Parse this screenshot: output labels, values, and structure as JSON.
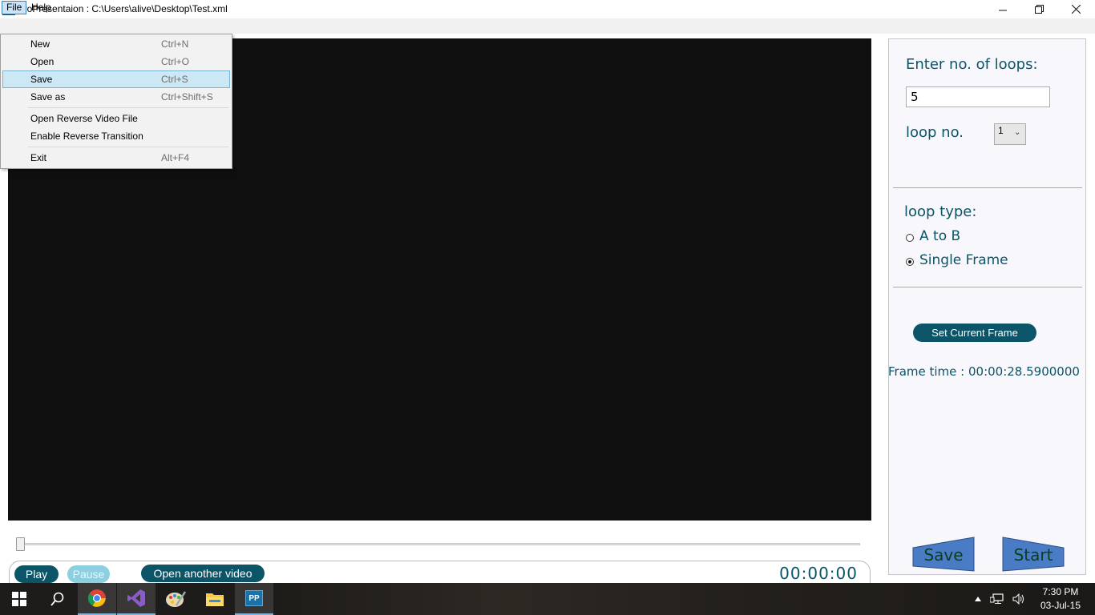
{
  "window": {
    "app_icon_text": "PP",
    "title": "proPresentaion : C:\\Users\\alive\\Desktop\\Test.xml",
    "controls": [
      "minimize-icon",
      "restore-icon",
      "close-icon"
    ]
  },
  "menubar": {
    "items": [
      {
        "label": "File"
      },
      {
        "label": "Help"
      }
    ]
  },
  "file_menu": {
    "items": [
      {
        "label": "New",
        "shortcut": "Ctrl+N",
        "highlighted": false
      },
      {
        "label": "Open",
        "shortcut": "Ctrl+O",
        "highlighted": false
      },
      {
        "label": "Save",
        "shortcut": "Ctrl+S",
        "highlighted": true
      },
      {
        "label": "Save as",
        "shortcut": "Ctrl+Shift+S",
        "highlighted": false
      },
      {
        "label": "Open Reverse Video File",
        "shortcut": ""
      },
      {
        "label": "Enable Reverse Transition",
        "shortcut": ""
      },
      {
        "label": "Exit",
        "shortcut": "Alt+F4"
      }
    ]
  },
  "player": {
    "seek_position": 0,
    "play_label": "Play",
    "pause_label": "Pause",
    "open_video_label": "Open another video",
    "time": "00:00:00"
  },
  "panel": {
    "loops_label": "Enter no. of loops:",
    "loops_value": "5",
    "loop_no_label": "loop no.",
    "loop_no_value": "1",
    "loop_type_label": "loop type:",
    "loop_type_options": [
      {
        "label": "A to B",
        "checked": false
      },
      {
        "label": "Single Frame",
        "checked": true
      }
    ],
    "set_frame_label": "Set Current Frame",
    "frame_time": "Frame time : 00:00:28.5900000",
    "save_label": "Save",
    "start_label": "Start"
  },
  "taskbar": {
    "apps": [
      "windows-start-icon",
      "search-icon",
      "chrome-icon",
      "visual-studio-icon",
      "paint-icon",
      "file-explorer-icon",
      "propresentation-app-icon"
    ],
    "clock_time": "7:30 PM",
    "clock_date": "03-Jul-15"
  },
  "colors": {
    "accent": "#0c5468",
    "pause_disabled": "#8ccfe0",
    "video_bg": "#0f0f0f",
    "shape_fill": "#4a7cc6"
  }
}
